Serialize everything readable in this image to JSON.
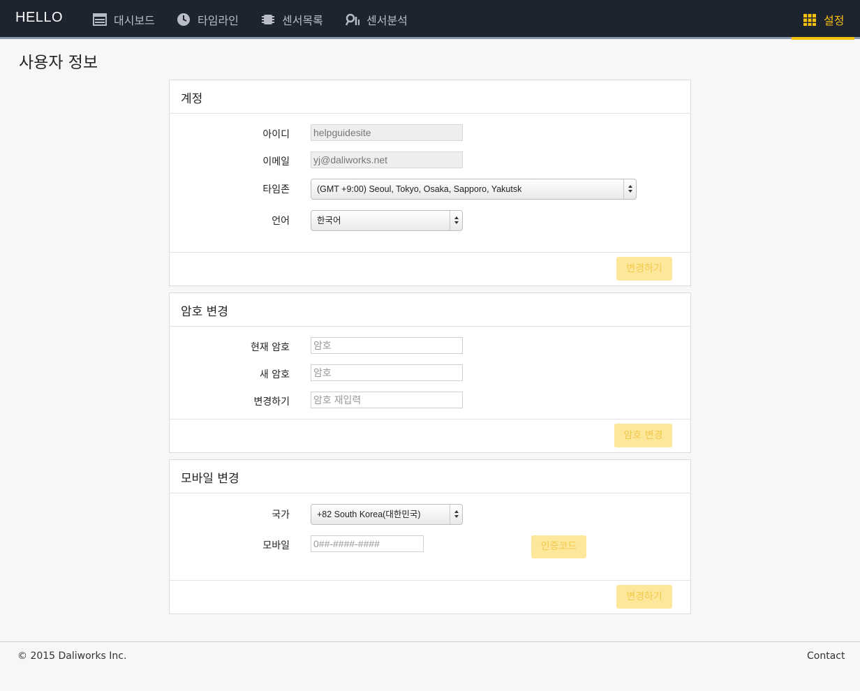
{
  "navbar": {
    "brand": "HELLO",
    "items": [
      {
        "label": "대시보드",
        "icon": "dashboard-icon"
      },
      {
        "label": "타임라인",
        "icon": "clock-icon"
      },
      {
        "label": "센서목록",
        "icon": "chip-icon"
      },
      {
        "label": "센서분석",
        "icon": "analysis-icon"
      },
      {
        "label": "설정",
        "icon": "grid-icon",
        "active": true
      }
    ],
    "active_color": "#f8c10b"
  },
  "page": {
    "title": "사용자 정보"
  },
  "account": {
    "heading": "계정",
    "id_label": "아이디",
    "id_value": "helpguidesite",
    "email_label": "이메일",
    "email_value": "yj@daliworks.net",
    "timezone_label": "타임존",
    "timezone_value": "(GMT +9:00) Seoul, Tokyo, Osaka, Sapporo, Yakutsk",
    "language_label": "언어",
    "language_value": "한국어",
    "submit_label": "변경하기"
  },
  "password": {
    "heading": "암호 변경",
    "current_label": "현재 암호",
    "current_placeholder": "암호",
    "new_label": "새 암호",
    "new_placeholder": "암호",
    "confirm_label": "변경하기",
    "confirm_placeholder": "암호 재입력",
    "submit_label": "암호 변경"
  },
  "mobile": {
    "heading": "모바일 변경",
    "country_label": "국가",
    "country_value": "+82 South Korea(대한민국)",
    "mobile_label": "모바일",
    "mobile_placeholder": "0##-####-####",
    "code_label": "인증코드",
    "submit_label": "변경하기"
  },
  "footer": {
    "copyright": "© 2015 Daliworks Inc.",
    "contact": "Contact"
  }
}
